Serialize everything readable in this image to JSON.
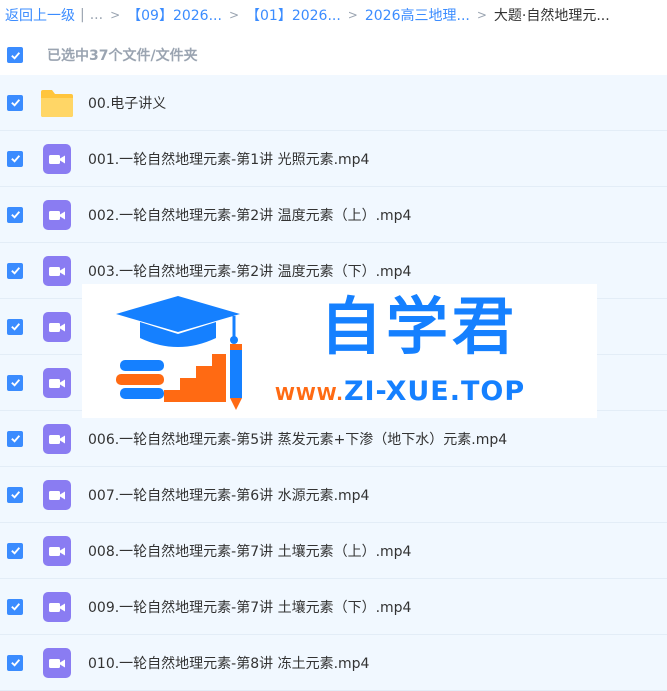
{
  "breadcrumb": {
    "back": "返回上一级",
    "divider": "|",
    "ellipsis": "...",
    "items": [
      "【09】2026...",
      "【01】2026...",
      "2026高三地理..."
    ],
    "current": "大题·自然地理元..."
  },
  "selection": {
    "text": "已选中37个文件/文件夹",
    "checked": true
  },
  "files": [
    {
      "name": "00.电子讲义",
      "icon": "folder-icon"
    },
    {
      "name": "001.一轮自然地理元素-第1讲 光照元素.mp4",
      "icon": "video-icon"
    },
    {
      "name": "002.一轮自然地理元素-第2讲 温度元素（上）.mp4",
      "icon": "video-icon"
    },
    {
      "name": "003.一轮自然地理元素-第2讲 温度元素（下）.mp4",
      "icon": "video-icon"
    },
    {
      "name": "",
      "icon": "video-icon"
    },
    {
      "name": "",
      "icon": "video-icon"
    },
    {
      "name": "006.一轮自然地理元素-第5讲 蒸发元素+下渗（地下水）元素.mp4",
      "icon": "video-icon"
    },
    {
      "name": "007.一轮自然地理元素-第6讲 水源元素.mp4",
      "icon": "video-icon"
    },
    {
      "name": "008.一轮自然地理元素-第7讲 土壤元素（上）.mp4",
      "icon": "video-icon"
    },
    {
      "name": "009.一轮自然地理元素-第7讲 土壤元素（下）.mp4",
      "icon": "video-icon"
    },
    {
      "name": "010.一轮自然地理元素-第8讲 冻土元素.mp4",
      "icon": "video-icon"
    }
  ],
  "watermark": {
    "brand": "自学君",
    "url_prefix": "WWW.",
    "url_main": "ZI-XUE.TOP"
  },
  "colors": {
    "accent": "#3b8cff",
    "row_background": "#f1f8ff",
    "folder": "#ffc53d",
    "video": "#8a7cf2",
    "watermark_blue": "#1580ff",
    "watermark_orange": "#ff6a13"
  }
}
